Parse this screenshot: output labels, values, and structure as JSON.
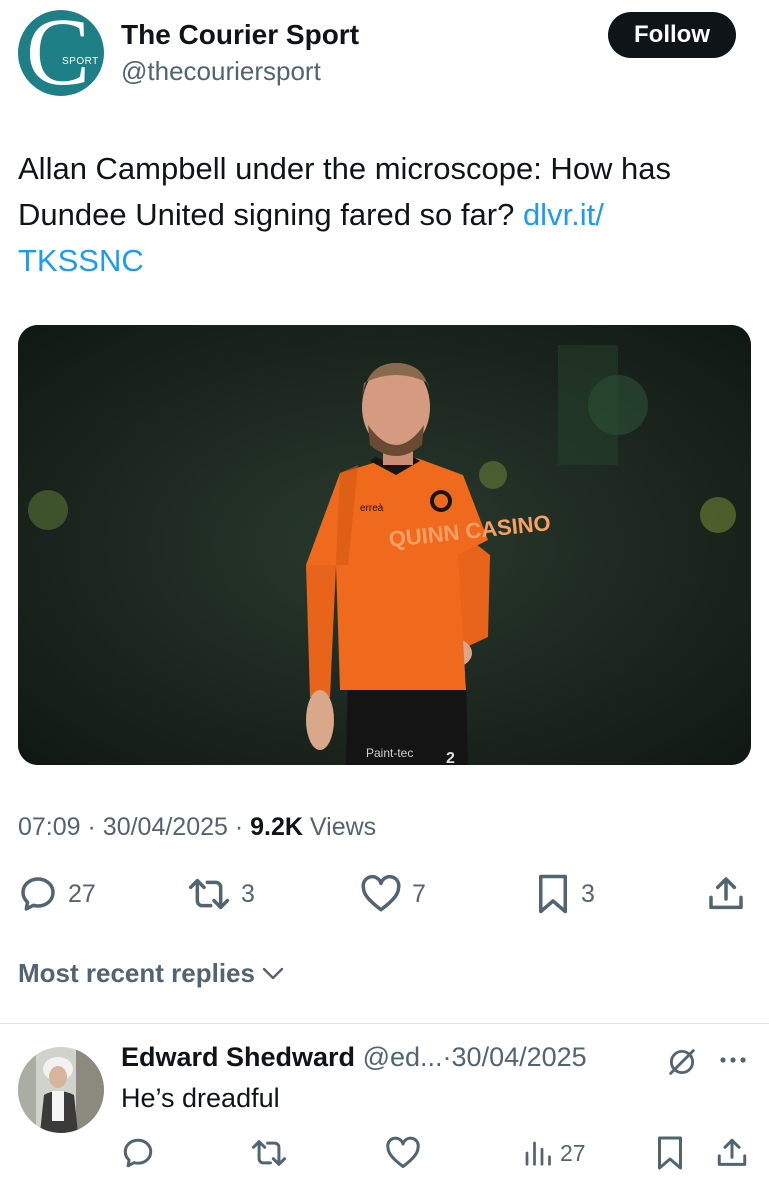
{
  "account": {
    "name": "The Courier Sport",
    "handle": "@thecouriersport",
    "avatar_letter": "C",
    "avatar_tag": "SPORT",
    "follow_label": "Follow"
  },
  "tweet": {
    "text": "Allan Campbell under the microscope: How has Dundee United signing fared so far? ",
    "link_text": "dlvr.it/\nTKSSNC",
    "time": "07:09",
    "date": "30/04/2025",
    "views_count": "9.2K",
    "views_label": "Views",
    "separator": "·"
  },
  "media": {
    "sponsor_text": "QUINN CASINO",
    "kit_brand": "erreà",
    "shorts_sponsor": "Paint-tec",
    "shirt_number": "2"
  },
  "actions": {
    "replies": "27",
    "reposts": "3",
    "likes": "7",
    "bookmarks": "3"
  },
  "replies_section": {
    "label": "Most recent replies"
  },
  "reply": {
    "name": "Edward Shedward",
    "handle": "@ed...",
    "separator": "·",
    "date": "30/04/2025",
    "text": "He’s dreadful",
    "views": "27"
  },
  "colors": {
    "brand_teal": "#1f7f86",
    "link_blue": "#1d9bf0",
    "kit_orange": "#ef6a1c",
    "secondary_text": "#536471"
  }
}
